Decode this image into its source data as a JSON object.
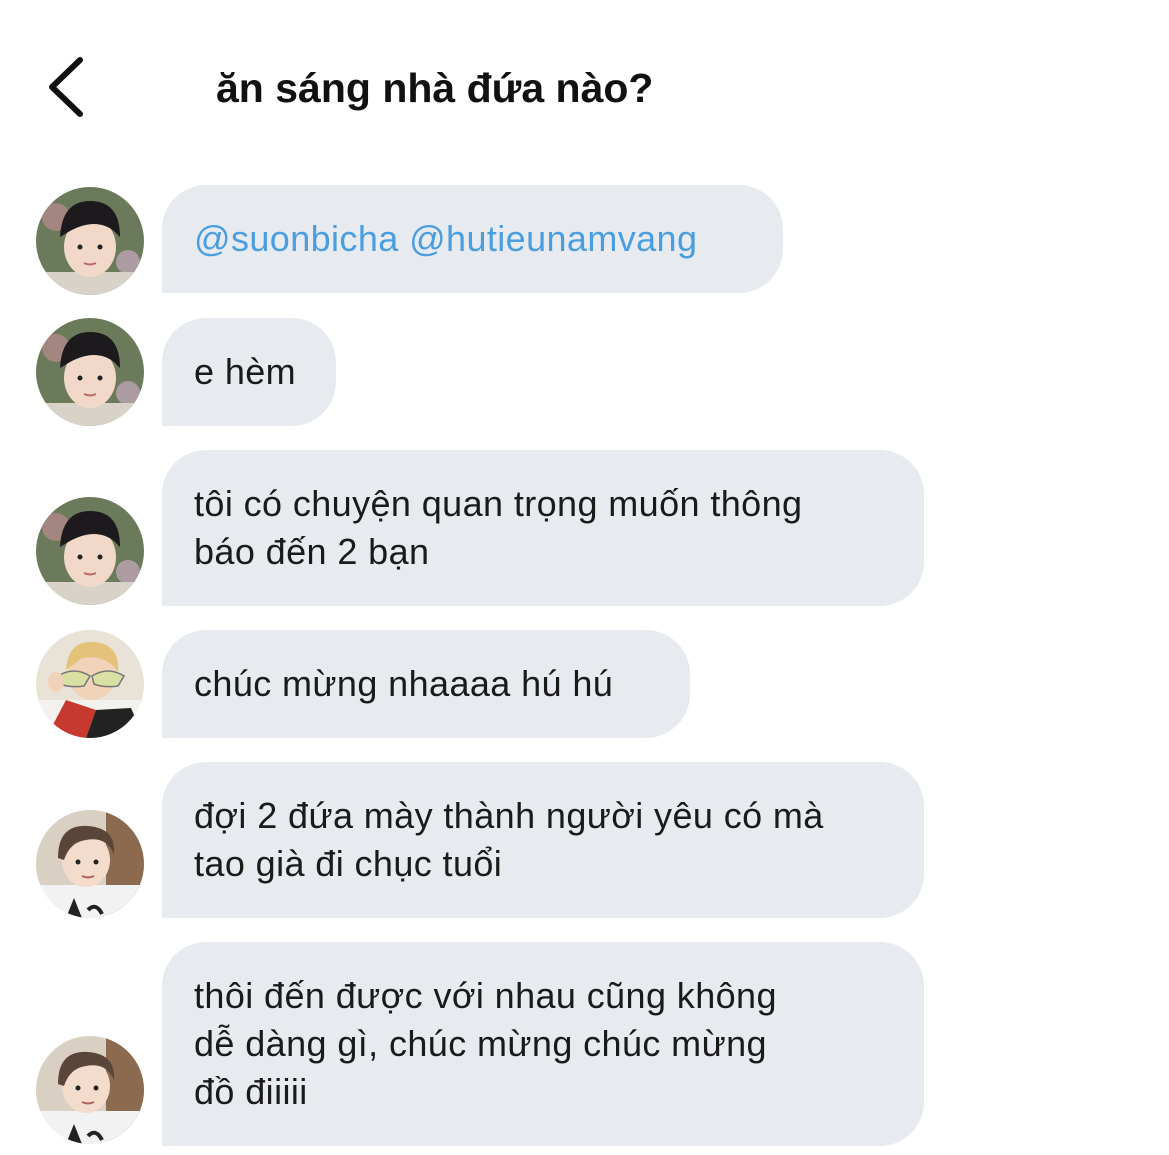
{
  "header": {
    "back_icon": "chevron-left-icon",
    "title": "ăn sáng nhà đứa nào?"
  },
  "messages": [
    {
      "avatar": "avatar-user-1",
      "mentions": "@suonbicha @hutieunamvang"
    },
    {
      "avatar": "avatar-user-1",
      "text": "e hèm"
    },
    {
      "avatar": "avatar-user-1",
      "lines": [
        "tôi có chuyện quan trọng muốn thông",
        "báo đến 2 bạn"
      ]
    },
    {
      "avatar": "avatar-user-2",
      "text": "chúc mừng nhaaaa hú hú"
    },
    {
      "avatar": "avatar-user-3",
      "lines": [
        "đợi 2 đứa mày thành người yêu có mà",
        "tao già đi chục tuổi"
      ]
    },
    {
      "avatar": "avatar-user-3",
      "lines": [
        "thôi đến được với nhau cũng không",
        "dễ dàng gì, chúc mừng chúc mừng",
        "đồ điiiii"
      ]
    }
  ],
  "colors": {
    "bubble": "#e7ebf0",
    "mention": "#4a9ee0",
    "text": "#1a1a1a"
  }
}
